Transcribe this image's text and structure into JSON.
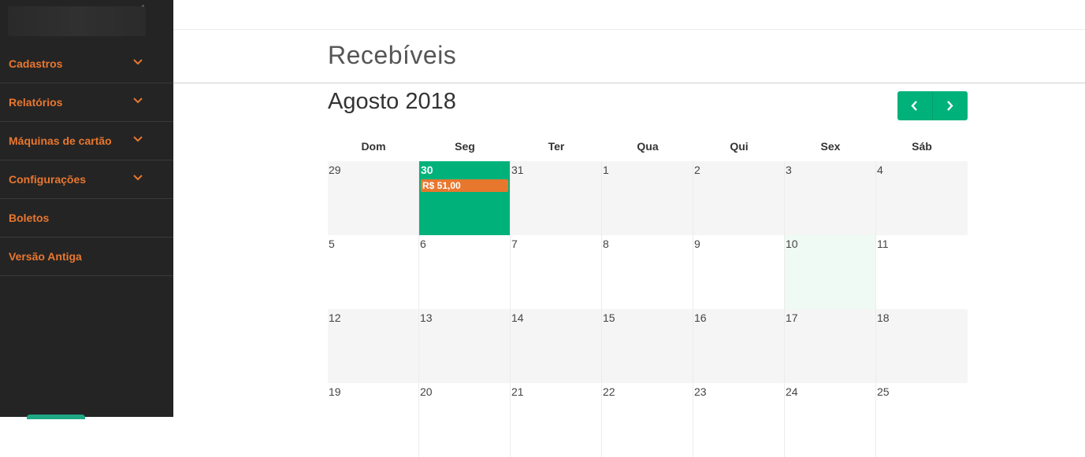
{
  "sidebar": {
    "items": [
      {
        "label": "Cadastros",
        "has_chevron": true
      },
      {
        "label": "Relatórios",
        "has_chevron": true
      },
      {
        "label": "Máquinas de cartão",
        "has_chevron": true
      },
      {
        "label": "Configurações",
        "has_chevron": true
      },
      {
        "label": "Boletos",
        "has_chevron": false
      },
      {
        "label": "Versão Antiga",
        "has_chevron": false
      }
    ]
  },
  "page": {
    "title": "Recebíveis"
  },
  "calendar": {
    "month_label": "Agosto 2018",
    "prev_icon": "chevron-left-icon",
    "next_icon": "chevron-right-icon",
    "weekdays": [
      "Dom",
      "Seg",
      "Ter",
      "Qua",
      "Qui",
      "Sex",
      "Sáb"
    ],
    "weeks": [
      [
        "29",
        "30",
        "31",
        "1",
        "2",
        "3",
        "4"
      ],
      [
        "5",
        "6",
        "7",
        "8",
        "9",
        "10",
        "11"
      ],
      [
        "12",
        "13",
        "14",
        "15",
        "16",
        "17",
        "18"
      ],
      [
        "19",
        "20",
        "21",
        "22",
        "23",
        "24",
        "25"
      ]
    ],
    "selected_day": "30",
    "today": "10",
    "events": [
      {
        "day": "30",
        "label": "R$ 51,00"
      }
    ]
  },
  "colors": {
    "accent_orange": "#e8772e",
    "accent_green": "#00b27a",
    "sidebar_bg": "#242424",
    "today_bg": "#effaf4"
  }
}
